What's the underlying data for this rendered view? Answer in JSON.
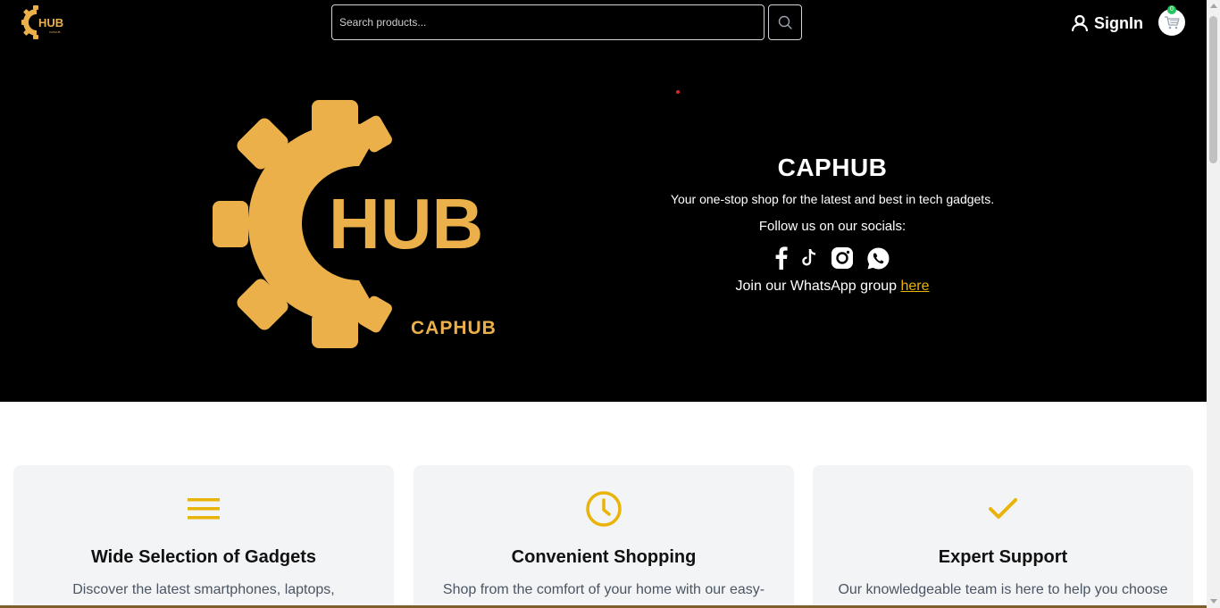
{
  "brand": {
    "logo_text": "HUB",
    "logo_subtext": "CAPHUB",
    "accent_color": "#EBB04A",
    "icon_color": "#EAB308"
  },
  "header": {
    "search_placeholder": "Search products...",
    "search_icon": "search-icon",
    "signin_label": "SignIn",
    "cart_icon": "cart-icon",
    "cart_count": "0"
  },
  "hero": {
    "title": "CAPHUB",
    "tagline": "Your one-stop shop for the latest and best in tech gadgets.",
    "follow_text": "Follow us on our socials:",
    "socials": [
      "facebook-icon",
      "tiktok-icon",
      "instagram-icon",
      "whatsapp-icon"
    ],
    "join_text": "Join our WhatsApp group ",
    "join_link": "here"
  },
  "features": [
    {
      "icon": "menu-icon",
      "title": "Wide Selection of Gadgets",
      "description": "Discover the latest smartphones, laptops,"
    },
    {
      "icon": "clock-icon",
      "title": "Convenient Shopping",
      "description": "Shop from the comfort of your home with our easy-"
    },
    {
      "icon": "check-icon",
      "title": "Expert Support",
      "description": "Our knowledgeable team is here to help you choose"
    }
  ]
}
